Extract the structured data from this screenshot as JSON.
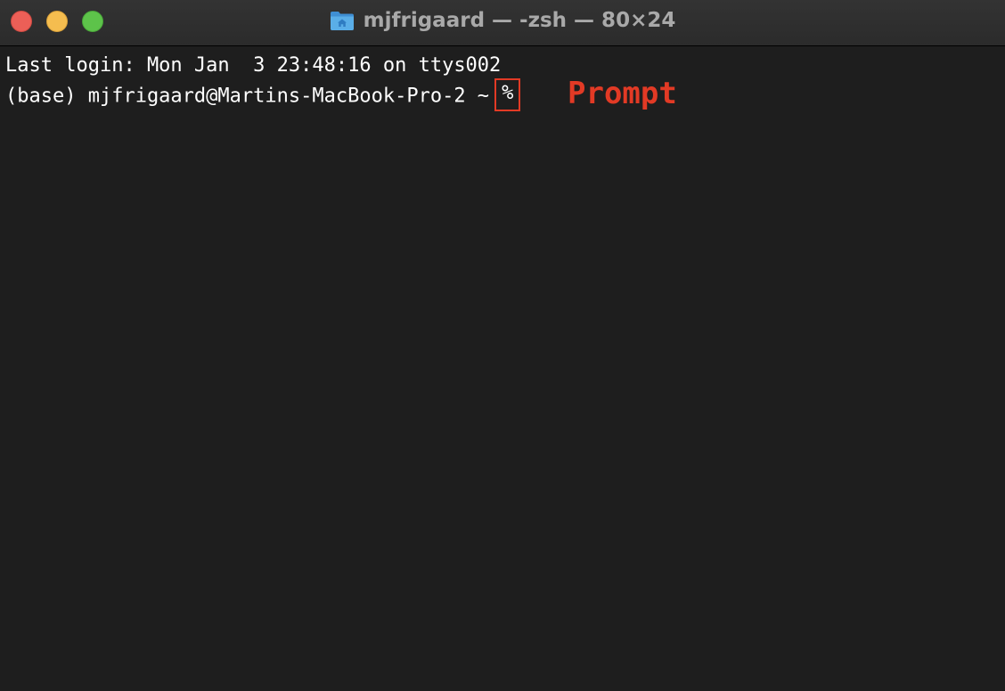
{
  "window": {
    "title": "mjfrigaard — -zsh — 80×24"
  },
  "terminal": {
    "line1": "Last login: Mon Jan  3 23:48:16 on ttys002",
    "line2_prefix": "(base) mjfrigaard@Martins-MacBook-Pro-2 ~",
    "prompt_symbol": "%"
  },
  "annotation": {
    "label": "Prompt",
    "color": "#e23a25"
  },
  "icons": {
    "title_icon": "home-folder-icon"
  },
  "colors": {
    "background": "#1e1e1e",
    "titlebar": "#2b2b2b",
    "close": "#ec5f57",
    "minimize": "#f5bd4f",
    "zoom": "#5dc34a"
  }
}
